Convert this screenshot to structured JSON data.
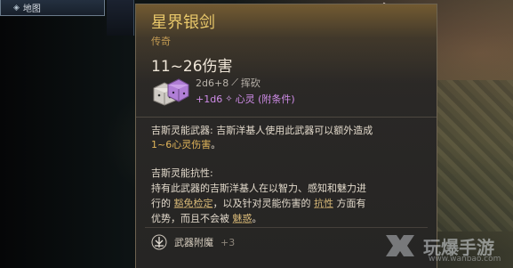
{
  "map_panel": {
    "label": "地图",
    "icon": "compass-icon"
  },
  "tooltip": {
    "name": "星界银剑",
    "rarity": "传奇",
    "damage_range": "11~26伤害",
    "damage_primary": {
      "dice": "2d6+8",
      "type": "挥砍",
      "icon": "slash-icon"
    },
    "damage_secondary": {
      "dice": "+1d6",
      "type": "心灵 (附条件)",
      "icon": "psychic-icon"
    },
    "rarity_color": "#c29a52",
    "name_color": "#e8c76a",
    "section1": {
      "title": "吉斯灵能武器:",
      "text": " 吉斯洋基人使用此武器可以额外造成",
      "highlight": "1~6心灵伤害",
      "end": "。"
    },
    "section2": {
      "title": "吉斯灵能抗性:",
      "line1": "持有此武器的吉斯洋基人在以智力、感知和魅力进",
      "line2_a": "行的 ",
      "kw1": "豁免检定",
      "line2_b": "，以及针对灵能伤害的 ",
      "kw2": "抗性",
      "line2_c": " 方面有",
      "line3_a": "优势，而且不会被 ",
      "kw3": "魅惑",
      "line3_b": "。"
    },
    "enchant": {
      "label": "武器附魔",
      "value": "+3",
      "icon": "enchant-icon"
    }
  },
  "watermark": {
    "text": "玩爆手游",
    "url": "www.wanbao.com"
  }
}
